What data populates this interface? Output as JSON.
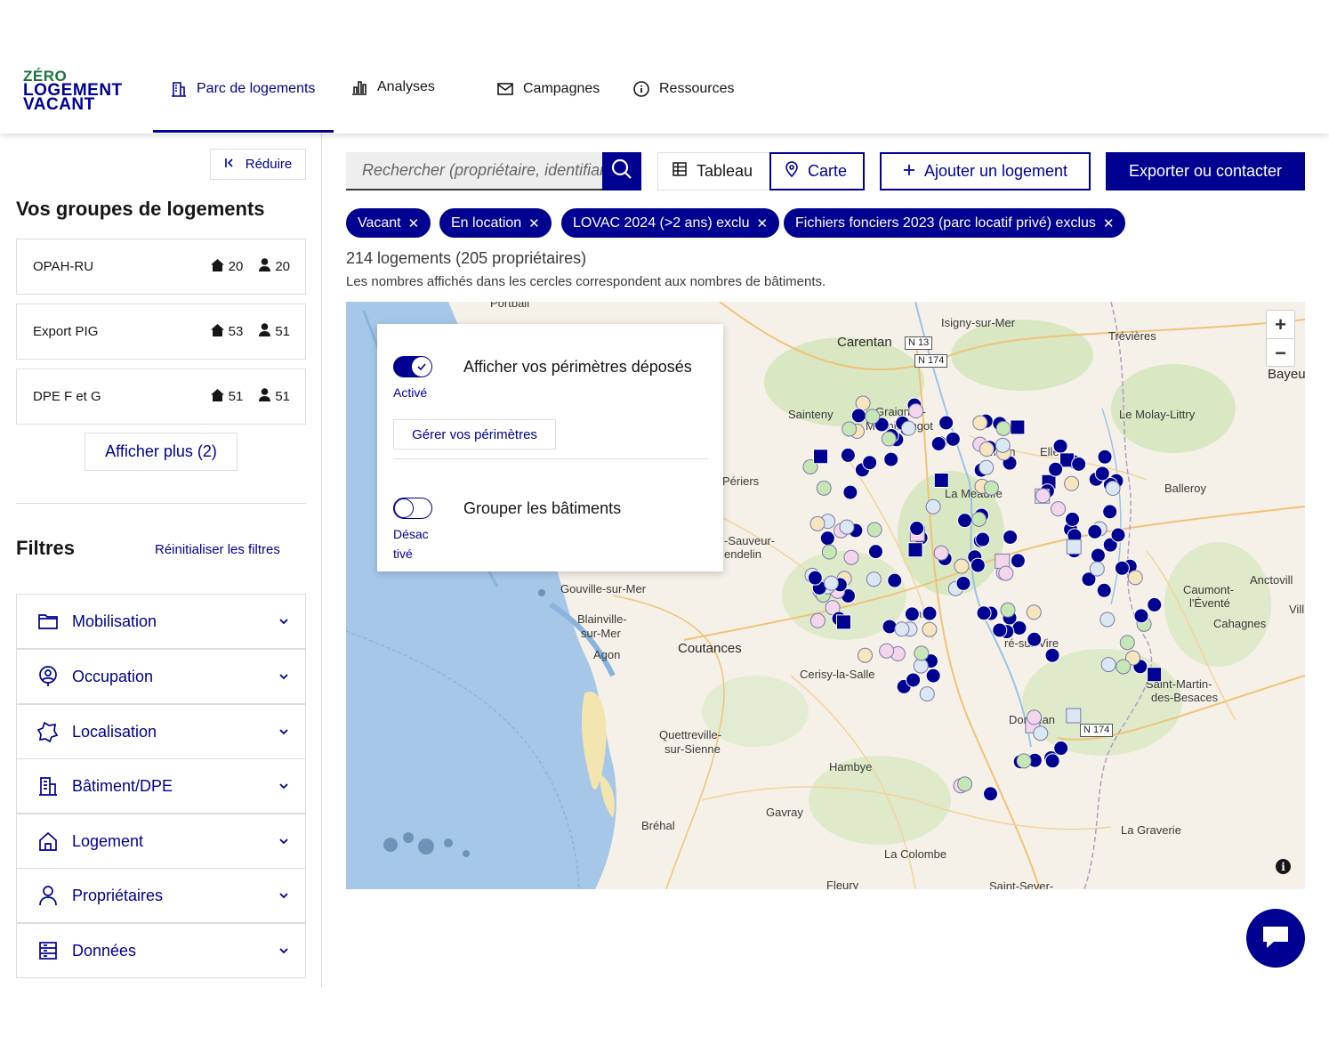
{
  "header": {
    "logo": [
      "ZÉRO",
      "LOGEMENT",
      "VACANT"
    ],
    "nav": [
      {
        "label": "Parc de logements",
        "icon": "building-icon",
        "active": true
      },
      {
        "label": "Analyses",
        "icon": "bar-chart-icon",
        "active": false
      },
      {
        "label": "Campagnes",
        "icon": "mail-icon",
        "active": false
      },
      {
        "label": "Ressources",
        "icon": "info-icon",
        "active": false
      }
    ]
  },
  "sidebar": {
    "reduce_label": "Réduire",
    "groups_title": "Vos groupes de logements",
    "groups": [
      {
        "name": "OPAH-RU",
        "housing": "20",
        "owners": "20"
      },
      {
        "name": "Export PIG",
        "housing": "53",
        "owners": "51"
      },
      {
        "name": "DPE F et G",
        "housing": "51",
        "owners": "51"
      }
    ],
    "more_label": "Afficher plus (2)",
    "filters_title": "Filtres",
    "reset_label": "Réinitialiser les filtres",
    "filters": [
      {
        "label": "Mobilisation",
        "icon": "folder-icon"
      },
      {
        "label": "Occupation",
        "icon": "user-pin-icon"
      },
      {
        "label": "Localisation",
        "icon": "map-region-icon"
      },
      {
        "label": "Bâtiment/DPE",
        "icon": "building-icon"
      },
      {
        "label": "Logement",
        "icon": "home-icon"
      },
      {
        "label": "Propriétaires",
        "icon": "user-icon"
      },
      {
        "label": "Données",
        "icon": "database-icon"
      }
    ]
  },
  "toolbar": {
    "search_placeholder": "Rechercher (propriétaire, identifiant fiscal...)",
    "tableau_label": "Tableau",
    "carte_label": "Carte",
    "add_label": "Ajouter un logement",
    "export_label": "Exporter ou contacter"
  },
  "tags": [
    "Vacant",
    "En location",
    "LOVAC 2024 (>2 ans) exclu",
    "Fichiers fonciers 2023 (parc locatif privé) exclus"
  ],
  "summary": {
    "count": "214 logements (205 propriétaires)",
    "hint": "Les nombres affichés dans les cercles correspondent aux nombres de bâtiments."
  },
  "map": {
    "panel": {
      "perimeters_toggle_label": "Afficher vos périmètres déposés",
      "perimeters_state": "Activé",
      "perimeters_button": "Gérer vos périmètres",
      "group_toggle_label": "Grouper les bâtiments",
      "group_state_line1": "Désac",
      "group_state_line2": "tivé"
    },
    "places": [
      "Portbail",
      "Carentan",
      "Isigny-sur-Mer",
      "Trévières",
      "Bayeu",
      "Sainteny",
      "Graignes-",
      "Mesnil-Angot",
      "Le Molay-Littry",
      "Moon",
      "Elle",
      "La Meauffe",
      "Balleroy",
      "Périers",
      "-Sauveur-",
      "endelin",
      "Gouville-sur-Mer",
      "Blainville-",
      "sur-Mer",
      "Agon",
      "Coutances",
      "Cerisy-la-Salle",
      "nisy",
      "ré-sur-Vire",
      "Caumont-",
      "l'Éventé",
      "Anctovill",
      "Vill",
      "Cahagnes",
      "Saint-Martin-",
      "des-Besaces",
      "Domjean",
      "Quettreville-",
      "sur-Sienne",
      "Hambye",
      "Gavray",
      "Bréhal",
      "La Graverie",
      "La Colombe",
      "Fleury",
      "Saint-Sever-"
    ],
    "roads": [
      "N 13",
      "N 174",
      "N 174"
    ],
    "zoom_in": "+",
    "zoom_out": "−",
    "attribution": "i"
  }
}
